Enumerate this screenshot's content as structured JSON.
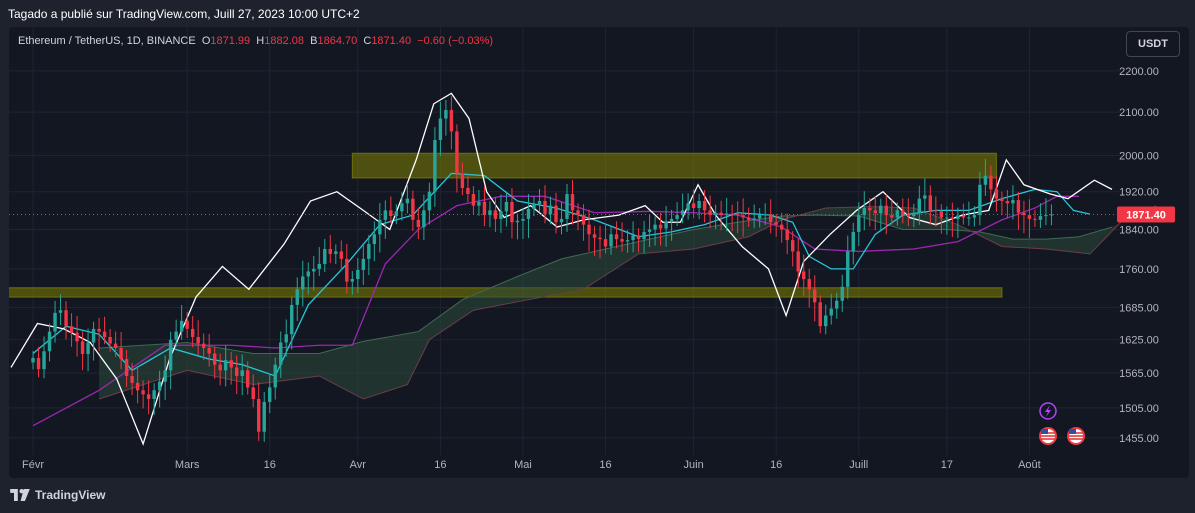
{
  "published_line": "Tagado a publié sur TradingView.com, Juill 27, 2023 10:00 UTC+2",
  "legend": {
    "symbol": "Ethereum / TetherUS, 1D, BINANCE",
    "o_label": "O",
    "o_value": "1871.99",
    "h_label": "H",
    "h_value": "1882.08",
    "b_label": "B",
    "b_value": "1864.70",
    "c_label": "C",
    "c_value": "1871.40",
    "change": "−0.60 (−0.03%)"
  },
  "currency_button": "USDT",
  "footer_brand": "TradingView",
  "colors": {
    "bg": "#131722",
    "up": "#26a69a",
    "down": "#f23645",
    "tenkan": "#26c6da",
    "kijun": "#9c27b0",
    "overlay_line": "#ffffff",
    "zone": "#808000",
    "cloud_bull": "#2e4a3a",
    "cloud_bear": "#4a2a33",
    "grid": "#1f2433"
  },
  "chart_data": {
    "type": "candlestick",
    "symbol": "ETHUSDT",
    "timeframe": "1D",
    "y_scale": "log",
    "ylim": [
      1440,
      2260
    ],
    "y_ticks": [
      "2200.00",
      "2100.00",
      "2000.00",
      "1920.00",
      "1840.00",
      "1760.00",
      "1685.00",
      "1625.00",
      "1565.00",
      "1505.00",
      "1455.00"
    ],
    "x_ticks": [
      "Févr",
      "Mars",
      "16",
      "Avr",
      "16",
      "Mai",
      "16",
      "Juin",
      "16",
      "Juill",
      "17",
      "Août"
    ],
    "x_tick_days": [
      0,
      28,
      43,
      59,
      74,
      89,
      104,
      120,
      135,
      150,
      166,
      181
    ],
    "last_price": 1871.4,
    "last_price_label": "1871.40",
    "zones": [
      {
        "from_day": 58,
        "to_day": 175,
        "low": 1950,
        "high": 2005
      },
      {
        "from_day": -10,
        "to_day": 176,
        "low": 1705,
        "high": 1723
      }
    ],
    "closes": [
      1592,
      1572,
      1604,
      1640,
      1675,
      1680,
      1650,
      1638,
      1622,
      1599,
      1620,
      1645,
      1640,
      1630,
      1618,
      1610,
      1590,
      1560,
      1548,
      1535,
      1528,
      1520,
      1535,
      1550,
      1570,
      1625,
      1640,
      1660,
      1645,
      1630,
      1618,
      1610,
      1600,
      1580,
      1570,
      1588,
      1575,
      1560,
      1570,
      1540,
      1520,
      1465,
      1515,
      1540,
      1580,
      1620,
      1635,
      1690,
      1720,
      1745,
      1755,
      1760,
      1770,
      1800,
      1790,
      1795,
      1780,
      1735,
      1740,
      1758,
      1780,
      1810,
      1830,
      1860,
      1880,
      1868,
      1878,
      1895,
      1905,
      1860,
      1845,
      1880,
      1920,
      2035,
      2085,
      2105,
      2055,
      1960,
      1928,
      1915,
      1890,
      1898,
      1870,
      1880,
      1862,
      1878,
      1898,
      1855,
      1858,
      1862,
      1883,
      1893,
      1900,
      1872,
      1890,
      1855,
      1862,
      1915,
      1880,
      1870,
      1850,
      1830,
      1823,
      1820,
      1805,
      1830,
      1820,
      1815,
      1818,
      1828,
      1820,
      1835,
      1840,
      1850,
      1842,
      1856,
      1862,
      1870,
      1880,
      1895,
      1885,
      1900,
      1880,
      1870,
      1875,
      1870,
      1873,
      1872,
      1870,
      1865,
      1860,
      1863,
      1870,
      1872,
      1855,
      1850,
      1840,
      1818,
      1795,
      1755,
      1740,
      1720,
      1695,
      1650,
      1670,
      1683,
      1698,
      1725,
      1795,
      1835,
      1870,
      1885,
      1880,
      1874,
      1890,
      1870,
      1865,
      1880,
      1872,
      1868,
      1875,
      1905,
      1912,
      1880,
      1878,
      1865,
      1865,
      1862,
      1869,
      1865,
      1865,
      1870,
      1935,
      1955,
      1925,
      1905,
      1900,
      1895,
      1902,
      1875,
      1870,
      1862,
      1860,
      1868,
      1870,
      1871.4
    ],
    "tenkan": [
      [
        0,
        1600
      ],
      [
        6,
        1650
      ],
      [
        12,
        1635
      ],
      [
        18,
        1570
      ],
      [
        25,
        1610
      ],
      [
        32,
        1590
      ],
      [
        38,
        1580
      ],
      [
        44,
        1560
      ],
      [
        50,
        1690
      ],
      [
        57,
        1770
      ],
      [
        63,
        1850
      ],
      [
        69,
        1870
      ],
      [
        76,
        1960
      ],
      [
        82,
        1955
      ],
      [
        88,
        1900
      ],
      [
        95,
        1885
      ],
      [
        102,
        1860
      ],
      [
        110,
        1825
      ],
      [
        116,
        1835
      ],
      [
        122,
        1850
      ],
      [
        128,
        1875
      ],
      [
        134,
        1870
      ],
      [
        138,
        1855
      ],
      [
        141,
        1785
      ],
      [
        145,
        1760
      ],
      [
        149,
        1760
      ],
      [
        153,
        1830
      ],
      [
        158,
        1870
      ],
      [
        164,
        1880
      ],
      [
        170,
        1880
      ],
      [
        176,
        1905
      ],
      [
        182,
        1925
      ],
      [
        186,
        1920
      ],
      [
        189,
        1880
      ],
      [
        192,
        1872
      ]
    ],
    "kijun": [
      [
        0,
        1475
      ],
      [
        12,
        1535
      ],
      [
        24,
        1615
      ],
      [
        36,
        1615
      ],
      [
        44,
        1610
      ],
      [
        52,
        1615
      ],
      [
        58,
        1615
      ],
      [
        64,
        1770
      ],
      [
        70,
        1840
      ],
      [
        77,
        1890
      ],
      [
        85,
        1910
      ],
      [
        93,
        1910
      ],
      [
        102,
        1875
      ],
      [
        112,
        1878
      ],
      [
        120,
        1875
      ],
      [
        128,
        1870
      ],
      [
        136,
        1845
      ],
      [
        142,
        1800
      ],
      [
        150,
        1795
      ],
      [
        160,
        1800
      ],
      [
        168,
        1815
      ],
      [
        176,
        1860
      ],
      [
        182,
        1885
      ],
      [
        186,
        1910
      ],
      [
        190,
        1910
      ]
    ],
    "overlay_line": [
      [
        0,
        1575
      ],
      [
        6,
        1655
      ],
      [
        12,
        1645
      ],
      [
        18,
        1620
      ],
      [
        24,
        1555
      ],
      [
        30,
        1445
      ],
      [
        36,
        1590
      ],
      [
        42,
        1705
      ],
      [
        48,
        1765
      ],
      [
        54,
        1720
      ],
      [
        62,
        1810
      ],
      [
        68,
        1900
      ],
      [
        74,
        1920
      ],
      [
        80,
        1880
      ],
      [
        86,
        1840
      ],
      [
        92,
        1990
      ],
      [
        96,
        2120
      ],
      [
        100,
        2145
      ],
      [
        104,
        2085
      ],
      [
        108,
        1920
      ],
      [
        112,
        1865
      ],
      [
        118,
        1890
      ],
      [
        124,
        1845
      ],
      [
        130,
        1860
      ],
      [
        138,
        1870
      ],
      [
        144,
        1890
      ],
      [
        148,
        1855
      ],
      [
        152,
        1855
      ],
      [
        156,
        1935
      ],
      [
        160,
        1870
      ],
      [
        166,
        1805
      ],
      [
        172,
        1760
      ],
      [
        176,
        1670
      ],
      [
        180,
        1775
      ],
      [
        186,
        1830
      ],
      [
        192,
        1880
      ],
      [
        198,
        1920
      ],
      [
        204,
        1865
      ],
      [
        210,
        1850
      ],
      [
        216,
        1870
      ],
      [
        222,
        1880
      ],
      [
        226,
        1990
      ],
      [
        230,
        1935
      ],
      [
        236,
        1915
      ],
      [
        240,
        1905
      ],
      [
        246,
        1945
      ],
      [
        250,
        1925
      ]
    ],
    "cloud_a": [
      [
        12,
        1610
      ],
      [
        28,
        1620
      ],
      [
        40,
        1600
      ],
      [
        52,
        1600
      ],
      [
        60,
        1622
      ],
      [
        70,
        1640
      ],
      [
        78,
        1700
      ],
      [
        88,
        1745
      ],
      [
        96,
        1780
      ],
      [
        104,
        1800
      ],
      [
        112,
        1820
      ],
      [
        120,
        1840
      ],
      [
        128,
        1855
      ],
      [
        136,
        1868
      ],
      [
        142,
        1870
      ],
      [
        150,
        1868
      ],
      [
        158,
        1840
      ],
      [
        166,
        1840
      ],
      [
        172,
        1835
      ],
      [
        178,
        1820
      ],
      [
        184,
        1820
      ],
      [
        190,
        1825
      ],
      [
        196,
        1845
      ]
    ],
    "cloud_b": [
      [
        12,
        1520
      ],
      [
        28,
        1570
      ],
      [
        40,
        1545
      ],
      [
        52,
        1560
      ],
      [
        60,
        1520
      ],
      [
        68,
        1545
      ],
      [
        72,
        1625
      ],
      [
        80,
        1680
      ],
      [
        90,
        1700
      ],
      [
        100,
        1720
      ],
      [
        110,
        1790
      ],
      [
        120,
        1800
      ],
      [
        130,
        1825
      ],
      [
        136,
        1860
      ],
      [
        144,
        1885
      ],
      [
        152,
        1888
      ],
      [
        160,
        1885
      ],
      [
        168,
        1850
      ],
      [
        176,
        1805
      ],
      [
        184,
        1800
      ],
      [
        192,
        1790
      ],
      [
        198,
        1860
      ],
      [
        204,
        1890
      ]
    ]
  },
  "event_icons": [
    "lightning-event-icon",
    "us-flag-event-icon",
    "us-flag-event-icon"
  ]
}
